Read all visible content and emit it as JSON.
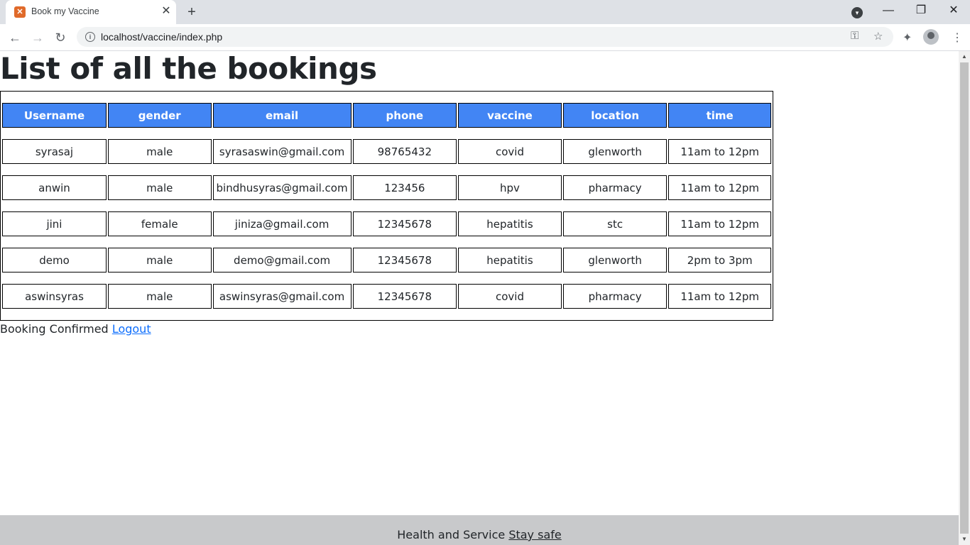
{
  "browser": {
    "tab_title": "Book my Vaccine",
    "favicon": "xampp-icon",
    "url": "localhost/vaccine/index.php"
  },
  "page": {
    "title": "List of all the bookings",
    "table": {
      "headers": [
        "Username",
        "gender",
        "email",
        "phone",
        "vaccine",
        "location",
        "time"
      ],
      "rows": [
        [
          "syrasaj",
          "male",
          "syrasaswin@gmail.com",
          "98765432",
          "covid",
          "glenworth",
          "11am to 12pm"
        ],
        [
          "anwin",
          "male",
          "bindhusyras@gmail.com",
          "123456",
          "hpv",
          "pharmacy",
          "11am to 12pm"
        ],
        [
          "jini",
          "female",
          "jiniza@gmail.com",
          "12345678",
          "hepatitis",
          "stc",
          "11am to 12pm"
        ],
        [
          "demo",
          "male",
          "demo@gmail.com",
          "12345678",
          "hepatitis",
          "glenworth",
          "2pm to 3pm"
        ],
        [
          "aswinsyras",
          "male",
          "aswinsyras@gmail.com",
          "12345678",
          "covid",
          "pharmacy",
          "11am to 12pm"
        ]
      ]
    },
    "status_text": "Booking Confirmed",
    "logout_label": "Logout",
    "footer_text": "Health and Service",
    "footer_link": "Stay safe"
  },
  "colors": {
    "header_bg": "#4285f4",
    "footer_bg": "#c8c9cb",
    "link": "#0d6efd"
  }
}
